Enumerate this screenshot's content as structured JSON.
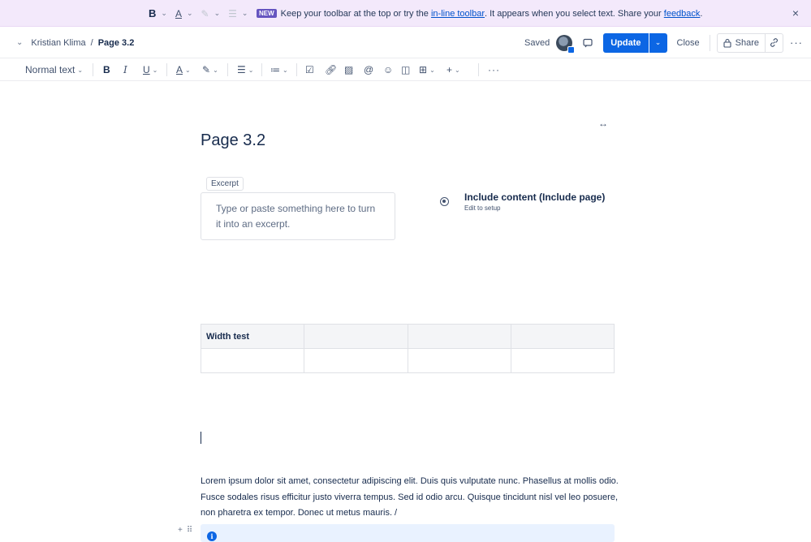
{
  "banner": {
    "tools": {
      "bold": "B",
      "text_color": "A",
      "highlight": "✎",
      "align": "☰"
    },
    "badge": "NEW",
    "message_pre": "Keep your toolbar at the top or try the",
    "inline_link": "in-line toolbar",
    "message_mid": ". It appears when you select text. Share your",
    "feedback_link": "feedback",
    "message_post": ".",
    "close_label": "×"
  },
  "header": {
    "breadcrumb_parent": "Kristian Klima",
    "breadcrumb_sep": "/",
    "breadcrumb_current": "Page 3.2",
    "saved_label": "Saved",
    "update_label": "Update",
    "close_label": "Close",
    "share_label": "Share",
    "more_label": "···"
  },
  "toolbar": {
    "text_style": "Normal text",
    "bold": "B",
    "italic": "I",
    "underline": "U",
    "text_color": "A",
    "more": "···"
  },
  "page": {
    "title": "Page 3.2",
    "width_toggle": "↔",
    "excerpt_tag": "Excerpt",
    "excerpt_placeholder": "Type or paste something here to turn it into an excerpt.",
    "macro_title": "Include content (Include page)",
    "macro_sub": "Edit to setup",
    "table": {
      "headers": [
        "Width test",
        "",
        "",
        ""
      ],
      "rows": [
        [
          "",
          "",
          "",
          ""
        ]
      ]
    },
    "paragraph": "Lorem ipsum dolor sit amet, consectetur adipiscing elit. Duis quis vulputate nunc. Phasellus at mollis odio. Fusce sodales risus efficitur justo viverra tempus. Sed id odio arcu. Quisque tincidunt nisl vel leo posuere, non pharetra ex tempor. Donec ut metus mauris. /",
    "info_icon": "i"
  },
  "colors": {
    "banner_bg": "#f3e9fb",
    "accent": "#0c66e4",
    "info_bg": "#e9f2ff"
  }
}
